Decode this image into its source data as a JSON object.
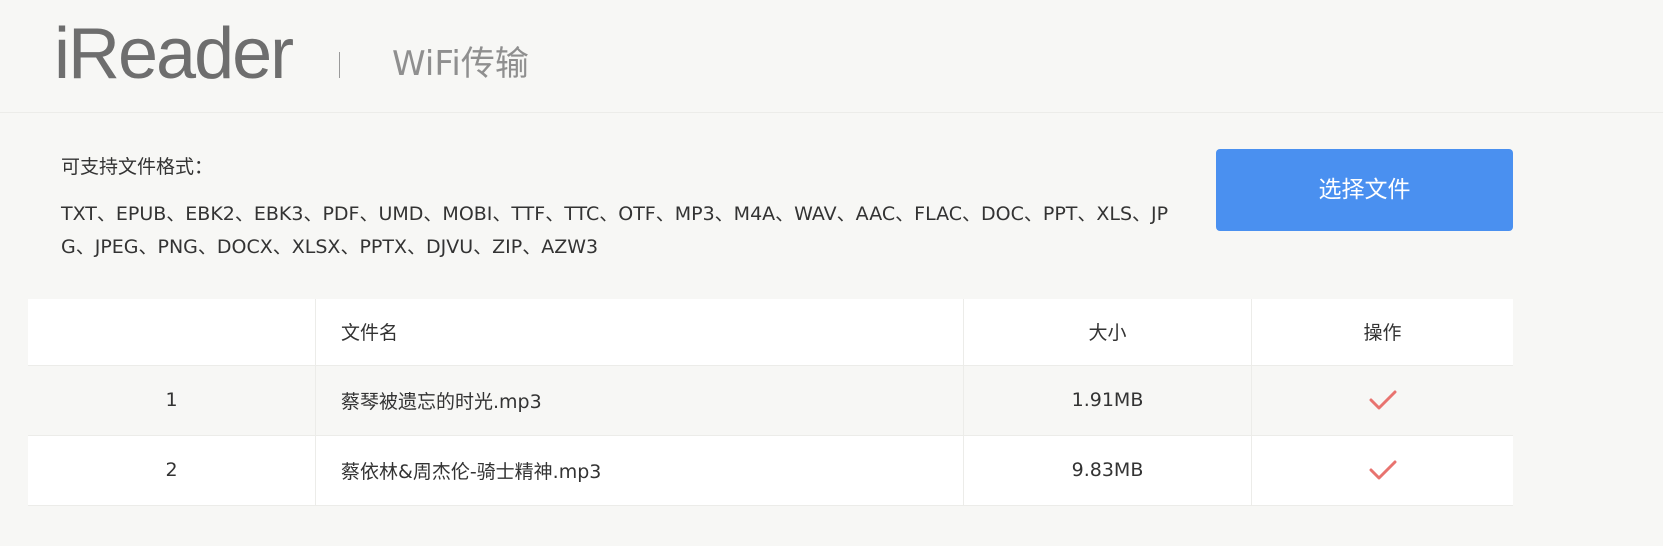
{
  "header": {
    "logo": "iReader",
    "title": "WiFi传输"
  },
  "formats": {
    "label": "可支持文件格式：",
    "list": "TXT、EPUB、EBK2、EBK3、PDF、UMD、MOBI、TTF、TTC、OTF、MP3、M4A、WAV、AAC、FLAC、DOC、PPT、XLS、JPG、JPEG、PNG、DOCX、XLSX、PPTX、DJVU、ZIP、AZW3"
  },
  "choose_button": {
    "label": "选择文件",
    "color": "#4a90f0"
  },
  "table": {
    "columns": [
      "",
      "文件名",
      "大小",
      "操作"
    ],
    "rows": [
      {
        "index": "1",
        "name": "蔡琴被遗忘的时光.mp3",
        "size": "1.91MB",
        "action_icon": "check-icon"
      },
      {
        "index": "2",
        "name": "蔡依林&周杰伦-骑士精神.mp3",
        "size": "9.83MB",
        "action_icon": "check-icon"
      }
    ],
    "check_color": "#e8736f"
  }
}
